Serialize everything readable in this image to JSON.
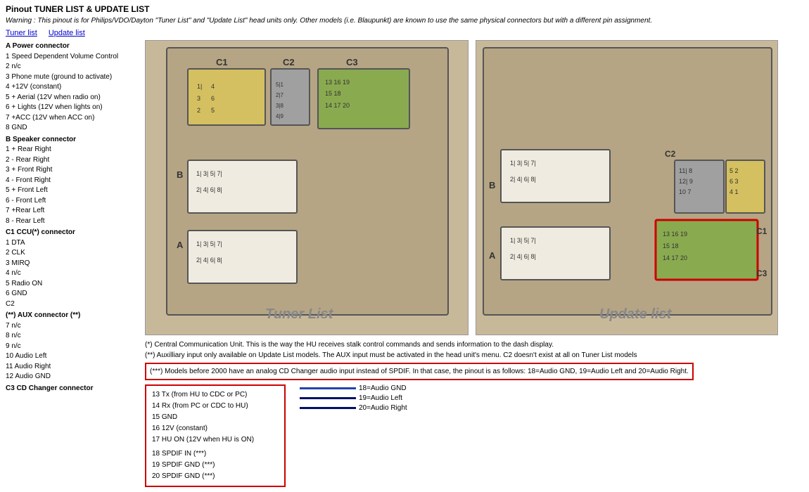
{
  "page": {
    "title": "Pinout TUNER LIST & UPDATE LIST",
    "warning": "Warning : This pinout is for Philips/VDO/Dayton \"Tuner List\" and \"Update List\" head units only. Other models (i.e. Blaupunkt) are known to use the same physical connectors but with a different pin assignment."
  },
  "tabs": {
    "tuner_list": "Tuner list",
    "update_list": "Update list"
  },
  "sections": {
    "power_connector": {
      "header": "A Power connector",
      "pins": [
        "1 Speed Dependent Volume Control",
        "2 n/c",
        "3 Phone mute (ground to activate)",
        "4 +12V (constant)",
        "5 + Aerial (12V when radio on)",
        "6 + Lights (12V when lights on)",
        "7 +ACC (12V when ACC on)",
        "8 GND"
      ]
    },
    "speaker_connector": {
      "header": "B Speaker connector",
      "pins": [
        "1 + Rear Right",
        "2 - Rear Right",
        "3 + Front Right",
        "4 - Front Right",
        "5 + Front Left",
        "6 - Front Left",
        "7 +Rear Left",
        "8 - Rear Left"
      ]
    },
    "ccu_connector": {
      "header": "C1 CCU(*) connector",
      "pins": [
        "1 DTA",
        "2 CLK",
        "3 MIRQ",
        "4 n/c",
        "5 Radio ON",
        "6 GND",
        "C2",
        "(**) AUX connector (**)",
        "7 n/c",
        "8 n/c",
        "9 n/c",
        "10 Audio Left",
        "11 Audio Right",
        "12 Audio GND",
        "C3 CD Changer connector"
      ]
    },
    "cdc_pins": [
      "13 Tx (from HU to CDC or PC)",
      "14 Rx (from PC or CDC to HU)",
      "15 GND",
      "16 12V (constant)",
      "17 HU ON (12V when HU is ON)"
    ],
    "spdif_pins": [
      {
        "num": "18",
        "label": "SPDIF IN (***)",
        "wire": "blue",
        "eq": "18=Audio GND"
      },
      {
        "num": "19",
        "label": "SPDIF GND (***)",
        "wire": "navy",
        "eq": "19=Audio Left"
      },
      {
        "num": "20",
        "label": "SPDIF GND (***)",
        "wire": "navy",
        "eq": "20=Audio Right"
      }
    ]
  },
  "footnotes": {
    "f1": "(*) Central Communication Unit. This is the way the HU receives stalk control commands and sends information to the dash display.",
    "f2": "(**) Auxilliary input only available on Update List models. The AUX input must be activated in the head unit's menu. C2 doesn't exist at all on Tuner List models",
    "f3": "(***) Models before 2000 have an analog CD Changer audio input instead of SPDIF. In that case, the pinout is as follows: 18=Audio GND, 19=Audio Left and 20=Audio Right."
  },
  "diagrams": {
    "tuner_label": "Tuner List",
    "update_label": "Update list"
  },
  "colors": {
    "red_border": "#cc0000",
    "wire_blue": "#2244aa",
    "wire_navy": "#001166"
  }
}
